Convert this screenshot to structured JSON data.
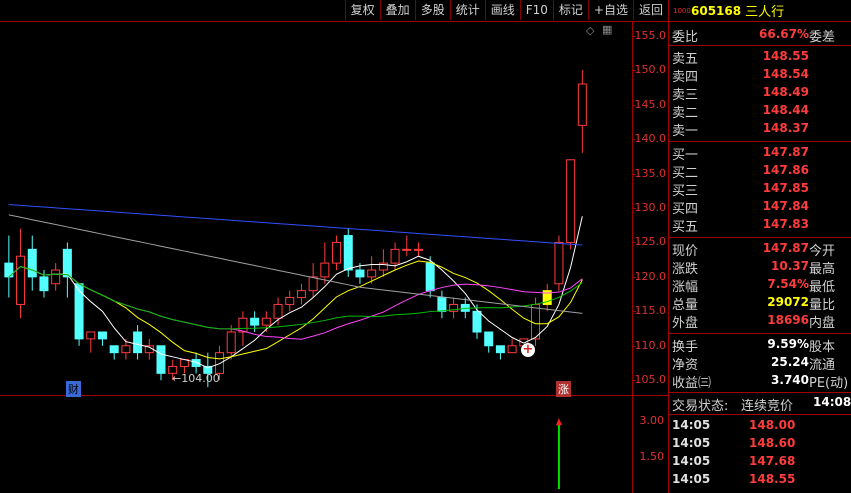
{
  "toolbar": [
    "复权",
    "叠加",
    "多股",
    "统计",
    "画线",
    "F10",
    "标记",
    "+自选",
    "返回"
  ],
  "stock": {
    "code": "605168",
    "name": "三人行",
    "badge": "1000"
  },
  "price_axis": [
    "155.0",
    "150.0",
    "145.0",
    "140.0",
    "135.0",
    "130.0",
    "125.0",
    "120.0",
    "115.0",
    "110.0",
    "105.0"
  ],
  "vol_axis": [
    "3.00",
    "1.50"
  ],
  "annotations": {
    "low_price": "←104.00",
    "cai": "财",
    "zhang": "涨"
  },
  "weibi": {
    "label": "委比",
    "value": "66.67%",
    "label2": "委差"
  },
  "sells": [
    {
      "label": "卖五",
      "price": "148.55"
    },
    {
      "label": "卖四",
      "price": "148.54"
    },
    {
      "label": "卖三",
      "price": "148.49"
    },
    {
      "label": "卖二",
      "price": "148.44"
    },
    {
      "label": "卖一",
      "price": "148.37"
    }
  ],
  "buys": [
    {
      "label": "买一",
      "price": "147.87"
    },
    {
      "label": "买二",
      "price": "147.86"
    },
    {
      "label": "买三",
      "price": "147.85"
    },
    {
      "label": "买四",
      "price": "147.84"
    },
    {
      "label": "买五",
      "price": "147.83"
    }
  ],
  "quote": [
    {
      "label": "现价",
      "value": "147.87",
      "label2": "今开",
      "color": "red"
    },
    {
      "label": "涨跌",
      "value": "10.37",
      "label2": "最高",
      "color": "red"
    },
    {
      "label": "涨幅",
      "value": "7.54%",
      "label2": "最低",
      "color": "red"
    },
    {
      "label": "总量",
      "value": "29072",
      "label2": "量比",
      "color": "yellow"
    },
    {
      "label": "外盘",
      "value": "18696",
      "label2": "内盘",
      "color": "red"
    }
  ],
  "fund": [
    {
      "label": "换手",
      "value": "9.59%",
      "label2": "股本"
    },
    {
      "label": "净资",
      "value": "25.24",
      "label2": "流通"
    },
    {
      "label": "收益㈢",
      "value": "3.740",
      "label2": "PE(动)"
    }
  ],
  "trade_status": {
    "label": "交易状态:",
    "value": "连续竞价",
    "time": "14:08:"
  },
  "trades": [
    {
      "time": "14:05",
      "price": "148.00"
    },
    {
      "time": "14:05",
      "price": "148.60"
    },
    {
      "time": "14:05",
      "price": "147.68"
    },
    {
      "time": "14:05",
      "price": "148.55"
    }
  ],
  "chart_data": {
    "type": "candlestick",
    "ylim": [
      103,
      157
    ],
    "candles": [
      {
        "o": 122,
        "c": 120,
        "h": 126,
        "l": 117
      },
      {
        "o": 116,
        "c": 123,
        "h": 127,
        "l": 114
      },
      {
        "o": 124,
        "c": 120,
        "h": 126,
        "l": 118
      },
      {
        "o": 120,
        "c": 118,
        "h": 121,
        "l": 117
      },
      {
        "o": 119,
        "c": 121,
        "h": 122,
        "l": 118
      },
      {
        "o": 124,
        "c": 120,
        "h": 125,
        "l": 117
      },
      {
        "o": 119,
        "c": 111,
        "h": 119,
        "l": 110
      },
      {
        "o": 111,
        "c": 112,
        "h": 112,
        "l": 109
      },
      {
        "o": 112,
        "c": 111,
        "h": 112,
        "l": 110
      },
      {
        "o": 110,
        "c": 109,
        "h": 110,
        "l": 108
      },
      {
        "o": 109,
        "c": 110,
        "h": 111,
        "l": 108
      },
      {
        "o": 112,
        "c": 109,
        "h": 113,
        "l": 108
      },
      {
        "o": 109,
        "c": 110,
        "h": 111,
        "l": 108
      },
      {
        "o": 110,
        "c": 106,
        "h": 110,
        "l": 105
      },
      {
        "o": 106,
        "c": 107,
        "h": 108,
        "l": 105
      },
      {
        "o": 107,
        "c": 108,
        "h": 108,
        "l": 106
      },
      {
        "o": 108,
        "c": 107,
        "h": 109,
        "l": 106
      },
      {
        "o": 107,
        "c": 106,
        "h": 109,
        "l": 104
      },
      {
        "o": 106,
        "c": 109,
        "h": 110,
        "l": 105
      },
      {
        "o": 109,
        "c": 112,
        "h": 113,
        "l": 108
      },
      {
        "o": 112,
        "c": 114,
        "h": 115,
        "l": 110
      },
      {
        "o": 114,
        "c": 113,
        "h": 115,
        "l": 112
      },
      {
        "o": 113,
        "c": 114,
        "h": 115,
        "l": 112
      },
      {
        "o": 114,
        "c": 116,
        "h": 117,
        "l": 113
      },
      {
        "o": 116,
        "c": 117,
        "h": 118,
        "l": 115
      },
      {
        "o": 117,
        "c": 118,
        "h": 119,
        "l": 116
      },
      {
        "o": 118,
        "c": 120,
        "h": 122,
        "l": 117
      },
      {
        "o": 120,
        "c": 122,
        "h": 125,
        "l": 119
      },
      {
        "o": 122,
        "c": 125,
        "h": 126,
        "l": 121
      },
      {
        "o": 126,
        "c": 121,
        "h": 127,
        "l": 120
      },
      {
        "o": 121,
        "c": 120,
        "h": 122,
        "l": 119
      },
      {
        "o": 120,
        "c": 121,
        "h": 123,
        "l": 119
      },
      {
        "o": 121,
        "c": 122,
        "h": 124,
        "l": 120
      },
      {
        "o": 122,
        "c": 124,
        "h": 125,
        "l": 121
      },
      {
        "o": 124,
        "c": 124,
        "h": 126,
        "l": 123
      },
      {
        "o": 124,
        "c": 124,
        "h": 125,
        "l": 123
      },
      {
        "o": 122,
        "c": 118,
        "h": 123,
        "l": 117
      },
      {
        "o": 117,
        "c": 115,
        "h": 118,
        "l": 114
      },
      {
        "o": 115,
        "c": 116,
        "h": 117,
        "l": 114
      },
      {
        "o": 116,
        "c": 115,
        "h": 117,
        "l": 114
      },
      {
        "o": 115,
        "c": 112,
        "h": 116,
        "l": 111
      },
      {
        "o": 112,
        "c": 110,
        "h": 112,
        "l": 109
      },
      {
        "o": 110,
        "c": 109,
        "h": 110,
        "l": 108
      },
      {
        "o": 109,
        "c": 110,
        "h": 111,
        "l": 109
      },
      {
        "o": 110,
        "c": 111,
        "h": 111,
        "l": 109
      },
      {
        "o": 111,
        "c": 116,
        "h": 117,
        "l": 110
      },
      {
        "o": 116,
        "c": 118,
        "h": 119,
        "l": 115
      },
      {
        "o": 119,
        "c": 125,
        "h": 126,
        "l": 118
      },
      {
        "o": 125,
        "c": 137,
        "h": 137,
        "l": 124
      },
      {
        "o": 142,
        "c": 148,
        "h": 150,
        "l": 138
      }
    ],
    "volume": {
      "ylim": [
        0,
        4
      ],
      "values": [
        0,
        0,
        0,
        0,
        0,
        0,
        0,
        0,
        0,
        0,
        0,
        0,
        0,
        0,
        0,
        0,
        0,
        0,
        0,
        0,
        0,
        0,
        0,
        0,
        0,
        0,
        0,
        0,
        0,
        0,
        0,
        0,
        0,
        0,
        0,
        0,
        0,
        0,
        0,
        0,
        0,
        0,
        0,
        0,
        0,
        0,
        0,
        3.2,
        0,
        0
      ]
    }
  }
}
